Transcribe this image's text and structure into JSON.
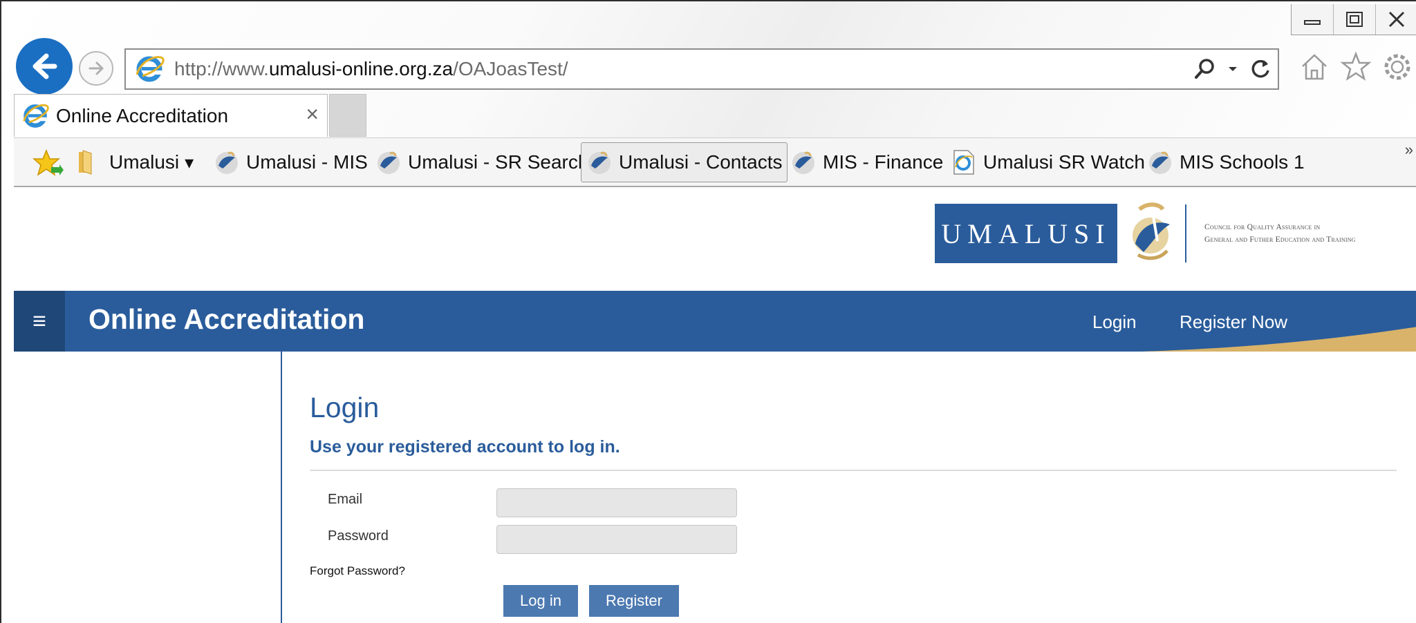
{
  "browser": {
    "address": {
      "prefix": "http://www.",
      "host": "umalusi-online.org.za",
      "path": "/OAJoasTest/"
    },
    "tab": {
      "label": "Online Accreditation",
      "close_glyph": "×"
    },
    "window_controls": {
      "minimize": "▭",
      "restore": "◻",
      "close": "✕"
    },
    "favorites": {
      "items": [
        {
          "label": "Umalusi",
          "icon": "folder-icon",
          "dropdown": true
        },
        {
          "label": "Umalusi - MIS",
          "icon": "umalusi-bird-icon"
        },
        {
          "label": "Umalusi - SR Search",
          "icon": "umalusi-bird-icon"
        },
        {
          "label": "Umalusi - Contacts",
          "icon": "umalusi-bird-icon",
          "active": true
        },
        {
          "label": "MIS - Finance",
          "icon": "umalusi-bird-icon"
        },
        {
          "label": "Umalusi SR Watch",
          "icon": "ie-page-icon"
        },
        {
          "label": "MIS Schools 1",
          "icon": "umalusi-bird-icon"
        }
      ],
      "dropdown_glyph": "▾",
      "more_glyph": "»"
    }
  },
  "page": {
    "logo": {
      "wordmark": "UMALUSI",
      "tagline_line1": "Council for Quality Assurance in",
      "tagline_line2": "General and Futher Education and Training"
    },
    "navbar": {
      "menu_glyph": "≡",
      "title": "Online Accreditation",
      "links": [
        "Login",
        "Register Now"
      ]
    },
    "login": {
      "title": "Login",
      "subtitle": "Use your registered account to log in.",
      "email_label": "Email",
      "email_value": "",
      "password_label": "Password",
      "password_value": "",
      "forgot_link": "Forgot Password?",
      "login_button": "Log in",
      "register_button": "Register"
    }
  },
  "colors": {
    "brand_blue": "#2a5c9b",
    "menu_dark": "#1f4778",
    "button_blue": "#4c79b0",
    "ie_back_blue": "#1b6fc2",
    "gold": "#d9b36a"
  }
}
